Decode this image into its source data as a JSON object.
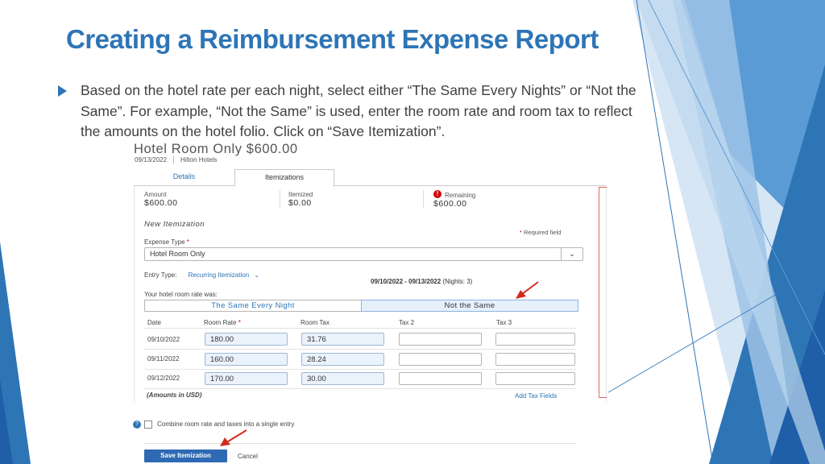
{
  "slide": {
    "title": "Creating a Reimbursement Expense Report",
    "bullet": "Based on the hotel rate per each night, select either “The Same Every Nights” or “Not the Same”. For example, “Not the Same” is used, enter the room rate and room tax to reflect the amounts on the hotel folio. Click on “Save Itemization”.",
    "theme_colors": {
      "title": "#2e75b6",
      "accent_dark": "#1f5fa8",
      "accent_light": "#bdd7ee"
    }
  },
  "screenshot": {
    "heading": "Hotel Room Only $600.00",
    "date": "09/13/2022",
    "vendor": "Hilton Hotels",
    "tabs": [
      "Details",
      "Itemizations"
    ],
    "active_tab": "Itemizations",
    "summary": {
      "amount_label": "Amount",
      "amount_value": "$600.00",
      "itemized_label": "Itemized",
      "itemized_value": "$0.00",
      "remaining_label": "Remaining",
      "remaining_value": "$600.00"
    },
    "new_itemization_label": "New Itemization",
    "required_field": "Required field",
    "expense_type_label": "Expense Type",
    "expense_type_value": "Hotel Room Only",
    "entry_type_label": "Entry Type:",
    "entry_type_value": "Recurring Itemization",
    "date_range": "09/10/2022 - 09/13/2022",
    "nights": "(Nights: 3)",
    "rate_was_label": "Your hotel room rate was:",
    "option_same": "The Same Every Night",
    "option_not_same": "Not the Same",
    "selected_option": "Not the Same",
    "columns": [
      "Date",
      "Room Rate",
      "Room Tax",
      "Tax 2",
      "Tax 3"
    ],
    "rows": [
      {
        "date": "09/10/2022",
        "room_rate": "180.00",
        "room_tax": "31.76",
        "tax2": "",
        "tax3": ""
      },
      {
        "date": "09/11/2022",
        "room_rate": "160.00",
        "room_tax": "28.24",
        "tax2": "",
        "tax3": ""
      },
      {
        "date": "09/12/2022",
        "room_rate": "170.00",
        "room_tax": "30.00",
        "tax2": "",
        "tax3": ""
      }
    ],
    "amounts_note": "(Amounts in USD)",
    "add_tax_fields": "Add Tax Fields",
    "combine_label": "Combine room rate and taxes into a single entry",
    "combine_checked": false,
    "save_button": "Save Itemization",
    "cancel_button": "Cancel"
  }
}
